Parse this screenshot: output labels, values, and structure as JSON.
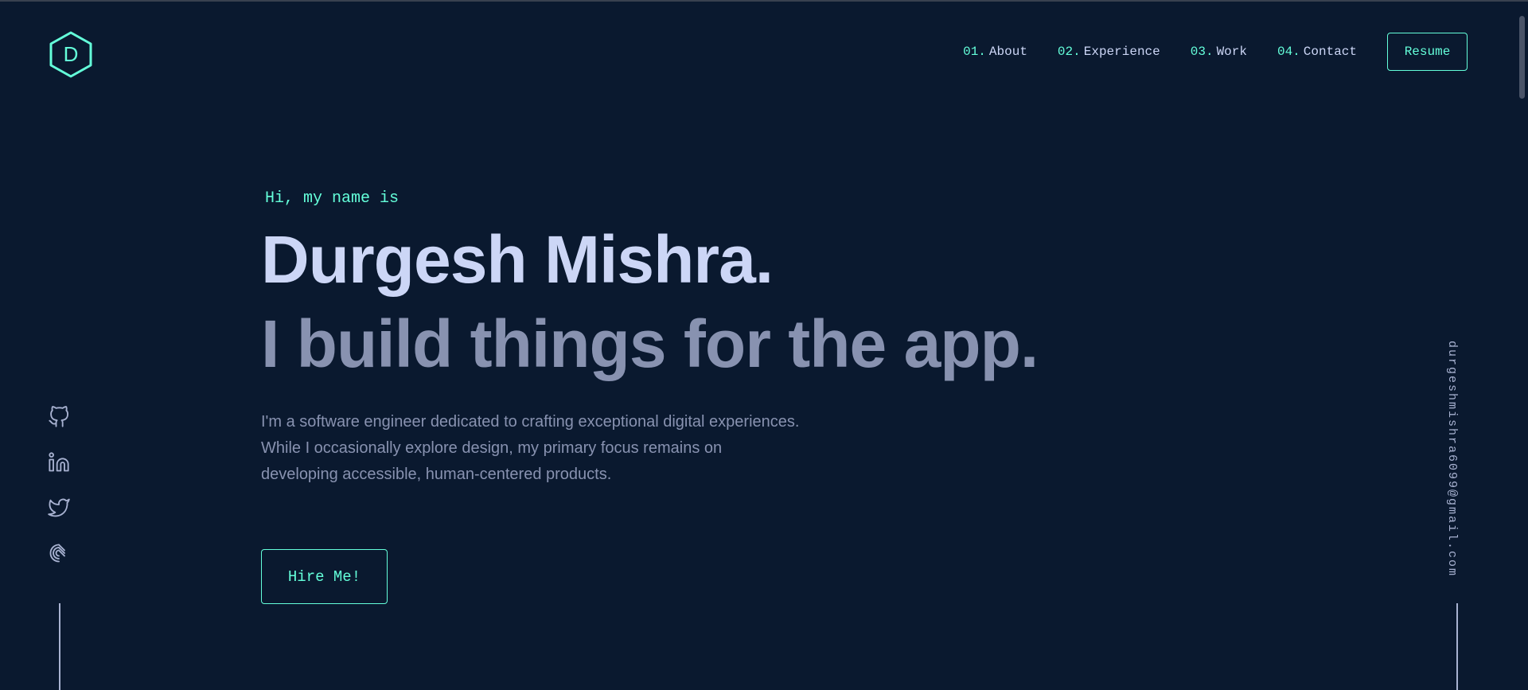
{
  "logo": {
    "letter": "D"
  },
  "nav": {
    "items": [
      {
        "num": "01.",
        "label": "About"
      },
      {
        "num": "02.",
        "label": "Experience"
      },
      {
        "num": "03.",
        "label": "Work"
      },
      {
        "num": "04.",
        "label": "Contact"
      }
    ],
    "resume_label": "Resume"
  },
  "hero": {
    "greeting": "Hi, my name is",
    "name": "Durgesh Mishra.",
    "tagline": "I build things for the app.",
    "intro": "I'm a software engineer dedicated to crafting exceptional digital experiences. While I occasionally explore design, my primary focus remains on developing accessible, human-centered products.",
    "cta_label": "Hire Me!"
  },
  "social": {
    "icons": [
      "github-icon",
      "linkedin-icon",
      "twitter-icon",
      "codechef-icon"
    ]
  },
  "email": "durgeshmishra6099@gmail.com",
  "colors": {
    "background": "#0a192f",
    "accent": "#64ffda",
    "heading": "#ccd6f6",
    "muted": "#8892b0"
  }
}
